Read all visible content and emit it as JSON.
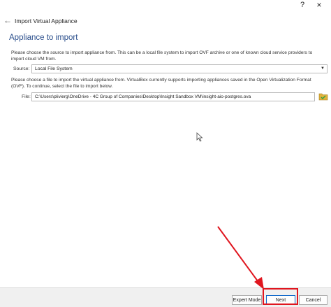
{
  "window": {
    "title": "Import Virtual Appliance",
    "help_label": "?",
    "close_label": "×",
    "back_label": "←"
  },
  "page": {
    "heading": "Appliance to import",
    "source_instructions": "Please choose the source to import appliance from. This can be a local file system to import OVF archive or one of known cloud service providers to import cloud VM from.",
    "source_label": "Source:",
    "source_value": "Local File System",
    "file_instructions": "Please choose a file to import the virtual appliance from. VirtualBox currently supports importing appliances saved in the Open Virtualization Format (OVF). To continue, select the file to import below.",
    "file_label": "File:",
    "file_value": "C:\\Users\\plivierg\\OneDrive - 4C Group of Companies\\Desktop\\Insight Sandbox VM\\insight-aio-postgres.ova"
  },
  "buttons": {
    "expert_mode": "Expert Mode",
    "next": "Next",
    "cancel": "Cancel"
  },
  "icons": {
    "back": "back-arrow-icon",
    "folder": "folder-open-icon",
    "dropdown": "chevron-down-icon",
    "cursor": "mouse-pointer-icon"
  },
  "colors": {
    "heading": "#2b4f8c",
    "annotation": "#e0161f",
    "folder": "#e0b23c",
    "folder_check": "#2f9e44"
  }
}
